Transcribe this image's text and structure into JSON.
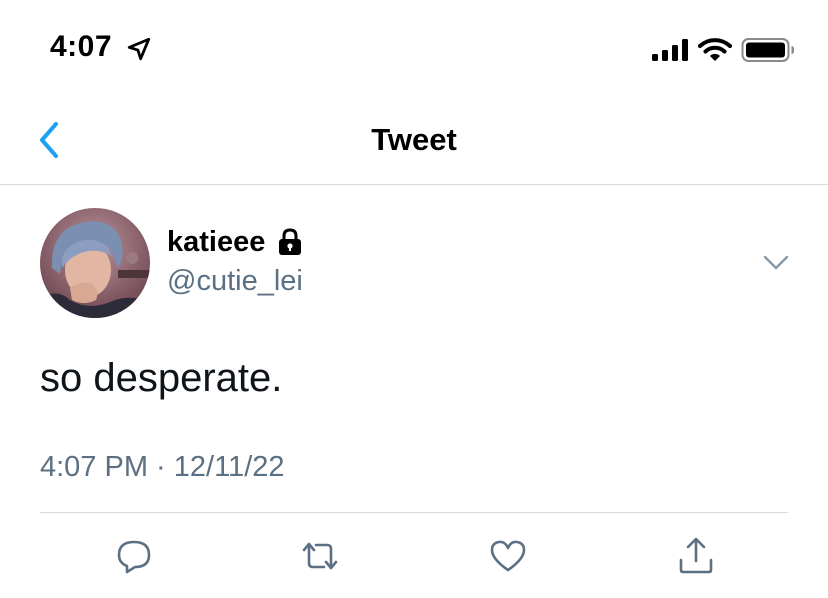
{
  "status_bar": {
    "time": "4:07",
    "icons": [
      "location-arrow-icon",
      "cellular-signal-icon",
      "wifi-icon",
      "battery-icon"
    ]
  },
  "nav": {
    "back_icon": "chevron-left-icon",
    "title": "Tweet"
  },
  "tweet": {
    "display_name": "katieee",
    "protected_icon": "lock-icon",
    "handle": "@cutie_lei",
    "text": "so desperate.",
    "timestamp": "4:07 PM · 12/11/22",
    "more_icon": "chevron-down-icon"
  },
  "actions": [
    {
      "name": "reply",
      "icon": "reply-icon"
    },
    {
      "name": "retweet",
      "icon": "retweet-icon"
    },
    {
      "name": "like",
      "icon": "heart-icon"
    },
    {
      "name": "share",
      "icon": "share-icon"
    }
  ],
  "colors": {
    "accent": "#1da1f2",
    "secondary_text": "#5b7083",
    "icon_gray": "#5b7083",
    "divider": "#d6dadd"
  }
}
